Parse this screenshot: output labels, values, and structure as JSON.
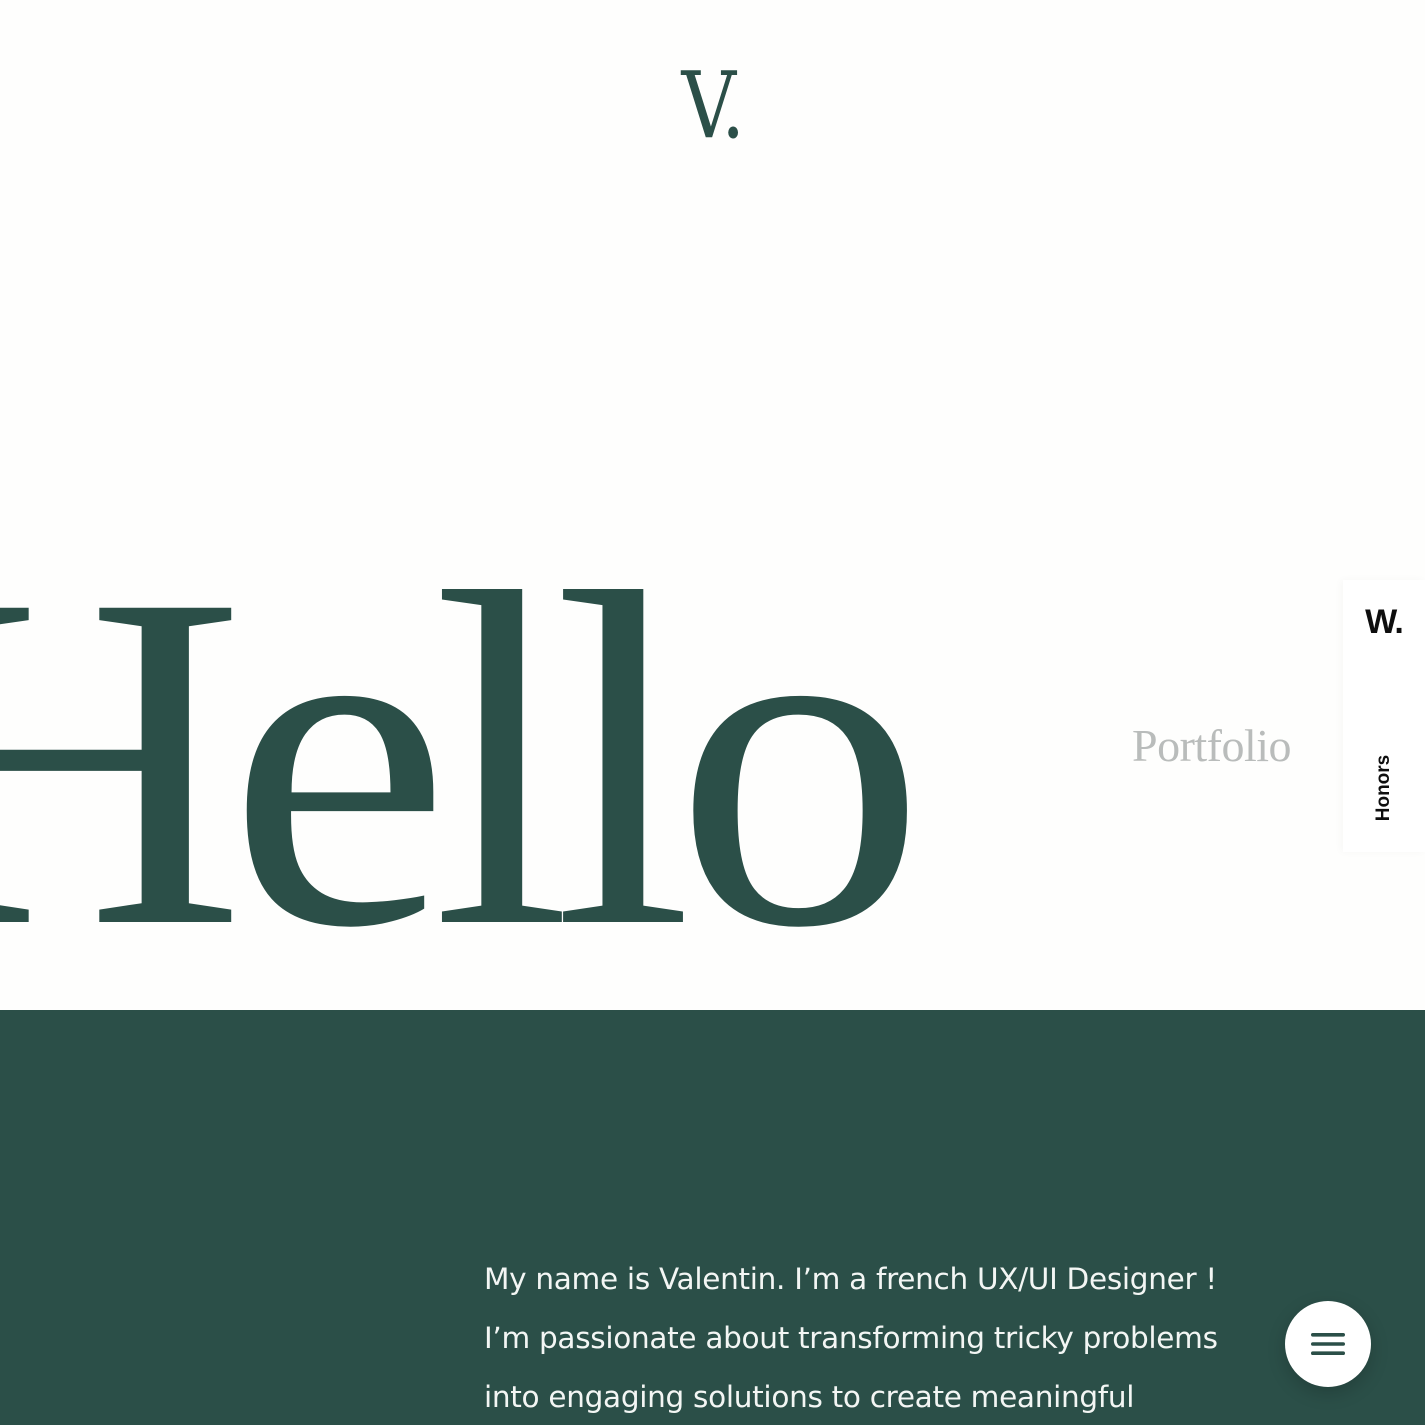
{
  "header": {
    "logo_text": "V."
  },
  "hero": {
    "headline": "Hello",
    "portfolio_link": "Portfolio"
  },
  "awards_tab": {
    "logo_text": "W.",
    "label": "Honors"
  },
  "intro": {
    "lines": [
      "My name is Valentin. I’m a french UX/UI Designer !",
      "I’m passionate about transforming tricky problems",
      "into engaging solutions to create meaningful"
    ]
  },
  "menu": {
    "icon": "hamburger-menu-icon"
  },
  "colors": {
    "brand_green": "#2b4f48",
    "background": "#fefefd",
    "muted_text": "#b9bcbb",
    "light_text": "#f3f6f4"
  }
}
